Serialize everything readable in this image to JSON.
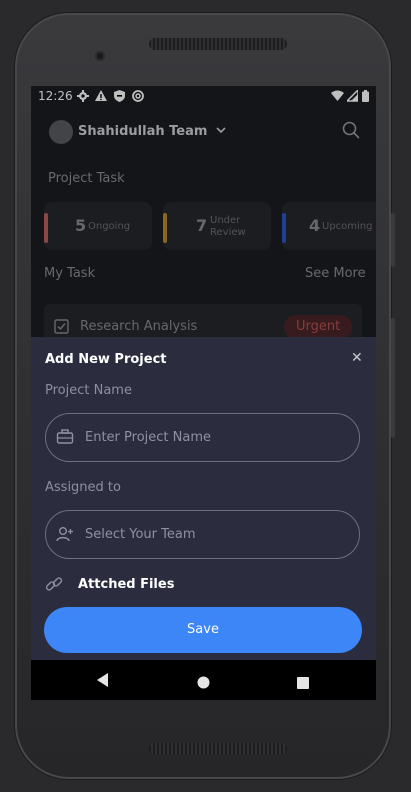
{
  "status_bar": {
    "time": "12:26",
    "left_icons": [
      "gear-icon",
      "warning-icon",
      "shield-icon",
      "sync-icon"
    ],
    "right_icons": [
      "wifi-icon",
      "signal-icon",
      "battery-icon"
    ]
  },
  "header": {
    "team_name": "Shahidullah Team"
  },
  "project_task": {
    "title": "Project Task",
    "cards": [
      {
        "count": "5",
        "label_line1": "Ongoing",
        "label_line2": "",
        "accent": "#b8605c"
      },
      {
        "count": "7",
        "label_line1": "Under",
        "label_line2": "Review",
        "accent": "#b48a2e"
      },
      {
        "count": "4",
        "label_line1": "Upcoming",
        "label_line2": "",
        "accent": "#2e55c8"
      }
    ]
  },
  "my_task": {
    "title": "My Task",
    "see_more": "See More",
    "tasks": [
      {
        "name": "Research Analysis",
        "badge": "Urgent",
        "checked": true
      }
    ]
  },
  "sheet": {
    "title": "Add New Project",
    "project_name_label": "Project Name",
    "project_name_placeholder": "Enter Project Name",
    "assigned_label": "Assigned to",
    "assigned_placeholder": "Select Your Team",
    "attached_label": "Attched Files",
    "save_label": "Save"
  },
  "colors": {
    "accent_blue": "#3d86f7",
    "sheet_bg": "#2b2d3f",
    "urgent": "#c05552"
  }
}
